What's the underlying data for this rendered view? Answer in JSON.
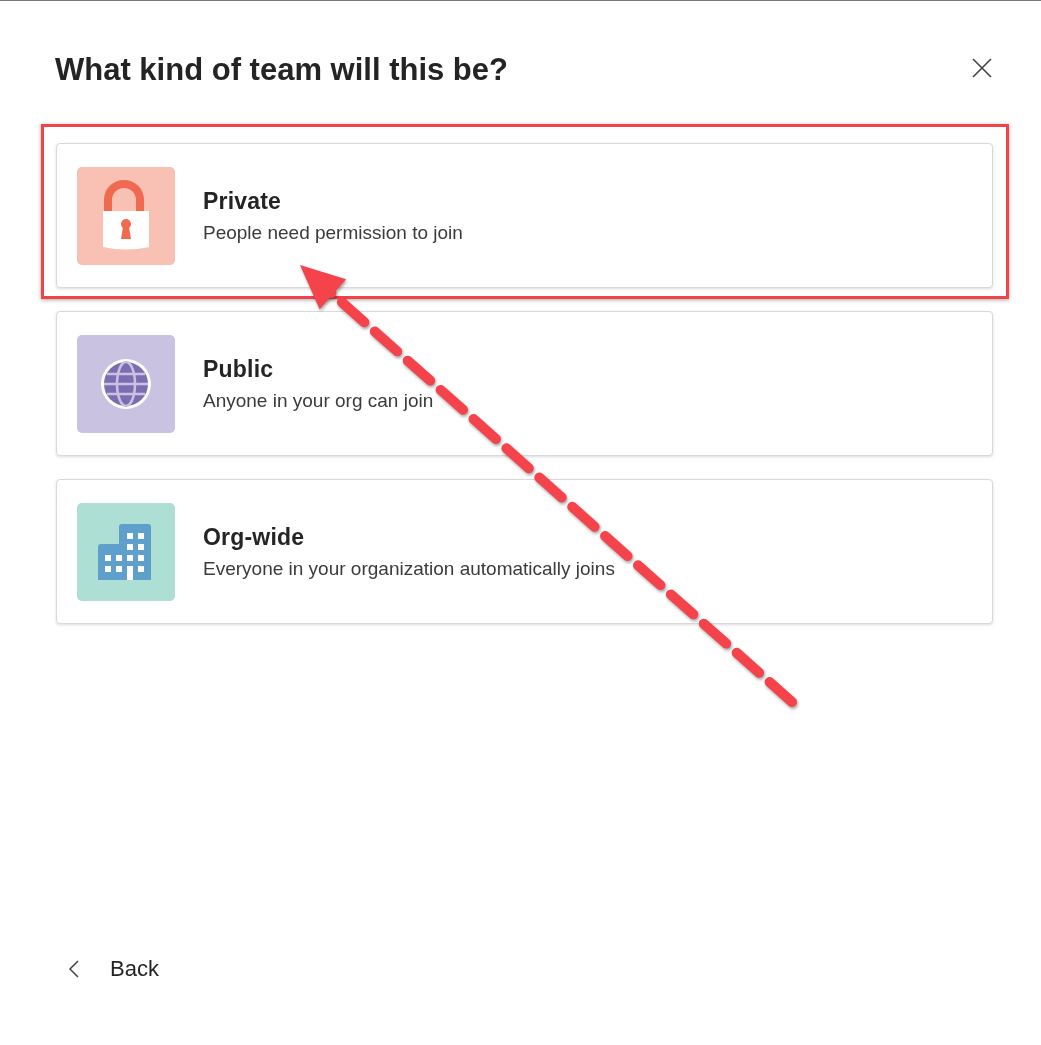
{
  "dialog": {
    "title": "What kind of team will this be?"
  },
  "options": [
    {
      "kind": "private",
      "title": "Private",
      "description": "People need permission to join",
      "highlighted": true
    },
    {
      "kind": "public",
      "title": "Public",
      "description": "Anyone in your org can join",
      "highlighted": false
    },
    {
      "kind": "org-wide",
      "title": "Org-wide",
      "description": "Everyone in your organization automatically joins",
      "highlighted": false
    }
  ],
  "annotation_arrow": true,
  "back": {
    "label": "Back"
  }
}
